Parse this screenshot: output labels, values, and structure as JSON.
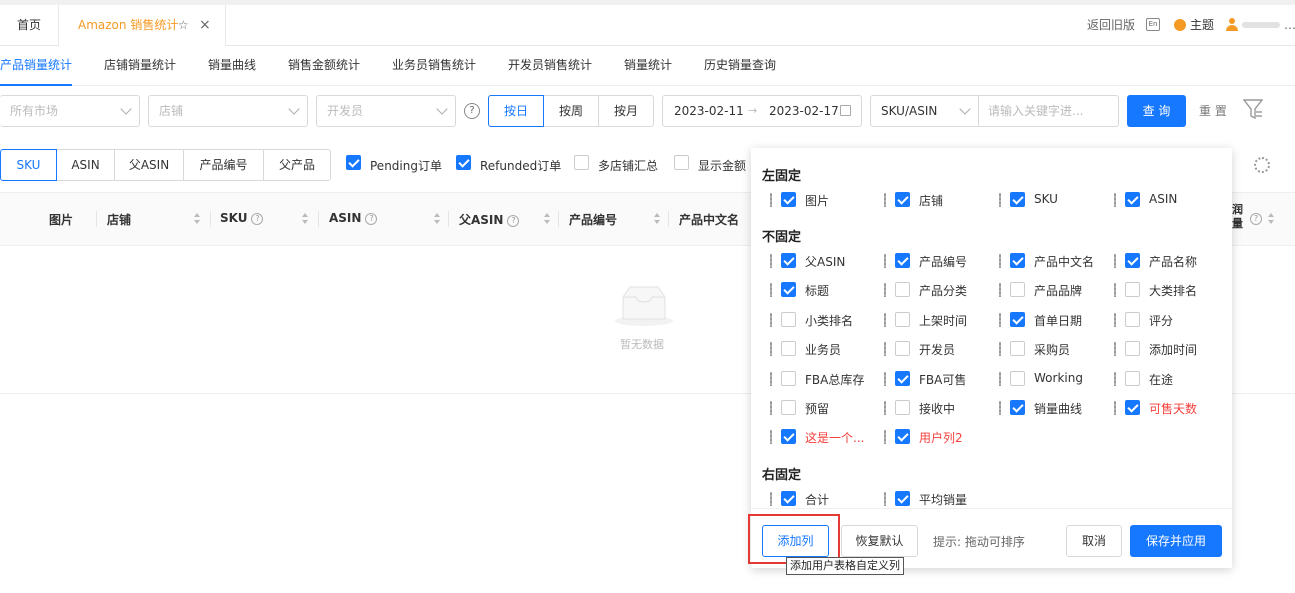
{
  "top_tabs": {
    "home": "首页",
    "active": "Amazon 销售统计",
    "back_old": "返回旧版",
    "en_label": "En",
    "theme": "主题"
  },
  "sub_tabs": [
    "产品销量统计",
    "店铺销量统计",
    "销量曲线",
    "销售金额统计",
    "业务员销售统计",
    "开发员销售统计",
    "销量统计",
    "历史销量查询"
  ],
  "filters": {
    "market_placeholder": "所有市场",
    "shop_placeholder": "店铺",
    "developer_placeholder": "开发员",
    "help": "?",
    "period": [
      "按日",
      "按周",
      "按月"
    ],
    "date_start": "2023-02-11",
    "date_sep": "→",
    "date_end": "2023-02-17",
    "search_type": "SKU/ASIN",
    "keyword_placeholder": "请输入关键字进...",
    "query": "查 询",
    "reset": "重 置"
  },
  "type_segments": [
    "SKU",
    "ASIN",
    "父ASIN",
    "产品编号",
    "父产品"
  ],
  "options": [
    {
      "label": "Pending订单",
      "checked": true
    },
    {
      "label": "Refunded订单",
      "checked": true
    },
    {
      "label": "多店铺汇总",
      "checked": false
    },
    {
      "label": "显示金额",
      "checked": false
    }
  ],
  "table": {
    "headers": [
      "图片",
      "店铺",
      "SKU",
      "ASIN",
      "父ASIN",
      "产品编号",
      "产品中文名"
    ],
    "right_header_fragment": "润\n量",
    "empty_text": "暂无数据"
  },
  "popover": {
    "left_title": "左固定",
    "left": [
      {
        "label": "图片",
        "checked": true
      },
      {
        "label": "店铺",
        "checked": true
      },
      {
        "label": "SKU",
        "checked": true
      },
      {
        "label": "ASIN",
        "checked": true
      }
    ],
    "unfixed_title": "不固定",
    "unfixed": [
      {
        "label": "父ASIN",
        "checked": true
      },
      {
        "label": "产品编号",
        "checked": true
      },
      {
        "label": "产品中文名",
        "checked": true
      },
      {
        "label": "产品名称",
        "checked": true
      },
      {
        "label": "标题",
        "checked": true
      },
      {
        "label": "产品分类",
        "checked": false
      },
      {
        "label": "产品品牌",
        "checked": false
      },
      {
        "label": "大类排名",
        "checked": false
      },
      {
        "label": "小类排名",
        "checked": false
      },
      {
        "label": "上架时间",
        "checked": false
      },
      {
        "label": "首单日期",
        "checked": true
      },
      {
        "label": "评分",
        "checked": false
      },
      {
        "label": "业务员",
        "checked": false
      },
      {
        "label": "开发员",
        "checked": false
      },
      {
        "label": "采购员",
        "checked": false
      },
      {
        "label": "添加时间",
        "checked": false
      },
      {
        "label": "FBA总库存",
        "checked": false
      },
      {
        "label": "FBA可售",
        "checked": true
      },
      {
        "label": "Working",
        "checked": false
      },
      {
        "label": "在途",
        "checked": false
      },
      {
        "label": "预留",
        "checked": false
      },
      {
        "label": "接收中",
        "checked": false
      },
      {
        "label": "销量曲线",
        "checked": true
      },
      {
        "label": "可售天数",
        "checked": true,
        "red": true
      },
      {
        "label": "这是一个...",
        "checked": true,
        "red": true
      },
      {
        "label": "用户列2",
        "checked": true,
        "red": true
      }
    ],
    "right_title": "右固定",
    "right": [
      {
        "label": "合计",
        "checked": true
      },
      {
        "label": "平均销量",
        "checked": true
      }
    ],
    "add_column": "添加列",
    "restore_default": "恢复默认",
    "hint": "提示: 拖动可排序",
    "cancel": "取消",
    "save_apply": "保存并应用",
    "tooltip": "添加用户表格自定义列"
  },
  "colors": {
    "accent": "#1677ff",
    "tab_active": "#f59a23",
    "red": "#f5403c"
  }
}
